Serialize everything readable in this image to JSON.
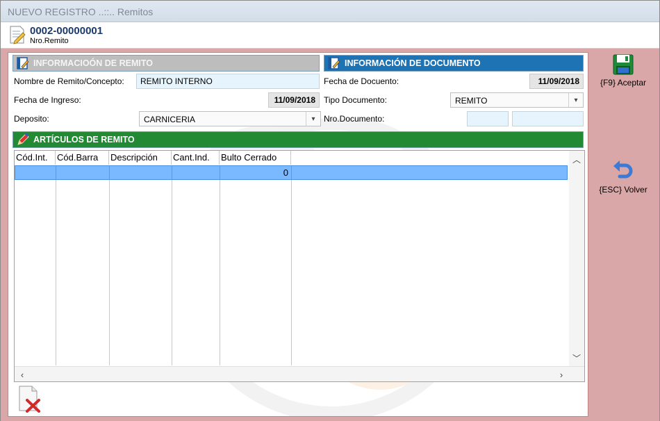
{
  "window": {
    "title": "NUEVO REGISTRO ..::.. Remitos"
  },
  "header": {
    "number": "0002-00000001",
    "sublabel": "Nro.Remito"
  },
  "remito_info": {
    "title": "INFORMACIOÓN DE REMITO",
    "concept_label": "Nombre de Remito/Concepto:",
    "concept_value": "REMITO INTERNO",
    "ingreso_label": "Fecha de Ingreso:",
    "ingreso_value": "11/09/2018",
    "deposito_label": "Deposito:",
    "deposito_value": "CARNICERIA"
  },
  "documento_info": {
    "title": "INFORMACIÓN DE DOCUMENTO",
    "fecha_label": "Fecha de Docuento:",
    "fecha_value": "11/09/2018",
    "tipo_label": "Tipo Documento:",
    "tipo_value": "REMITO",
    "nro_label": "Nro.Documento:",
    "nro_value_1": "",
    "nro_value_2": ""
  },
  "articulos": {
    "title": "ARTÍCULOS DE REMITO",
    "columns": [
      "Cód.Int.",
      "Cód.Barra",
      "Descripción",
      "Cant.Ind.",
      "Bulto Cerrado"
    ],
    "rows": [
      {
        "cod_int": "",
        "cod_barra": "",
        "descripcion": "",
        "cant_ind": "",
        "bulto_cerrado": "0"
      }
    ]
  },
  "actions": {
    "accept_label": "{F9} Aceptar",
    "back_label": "{ESC} Volver"
  },
  "icons": {
    "doc": "edit-document-icon",
    "section": "notebook-pencil-icon",
    "articles": "pencil-icon",
    "save": "floppy-disk-icon",
    "back": "undo-arrow-icon",
    "delete": "delete-document-icon"
  },
  "colors": {
    "section_gray": "#bdbdbd",
    "section_blue": "#1e73b5",
    "section_green": "#238a34",
    "content_bg": "#d9a7a7",
    "selected_row": "#7ab8ff",
    "input_bg": "#e6f4fd"
  }
}
